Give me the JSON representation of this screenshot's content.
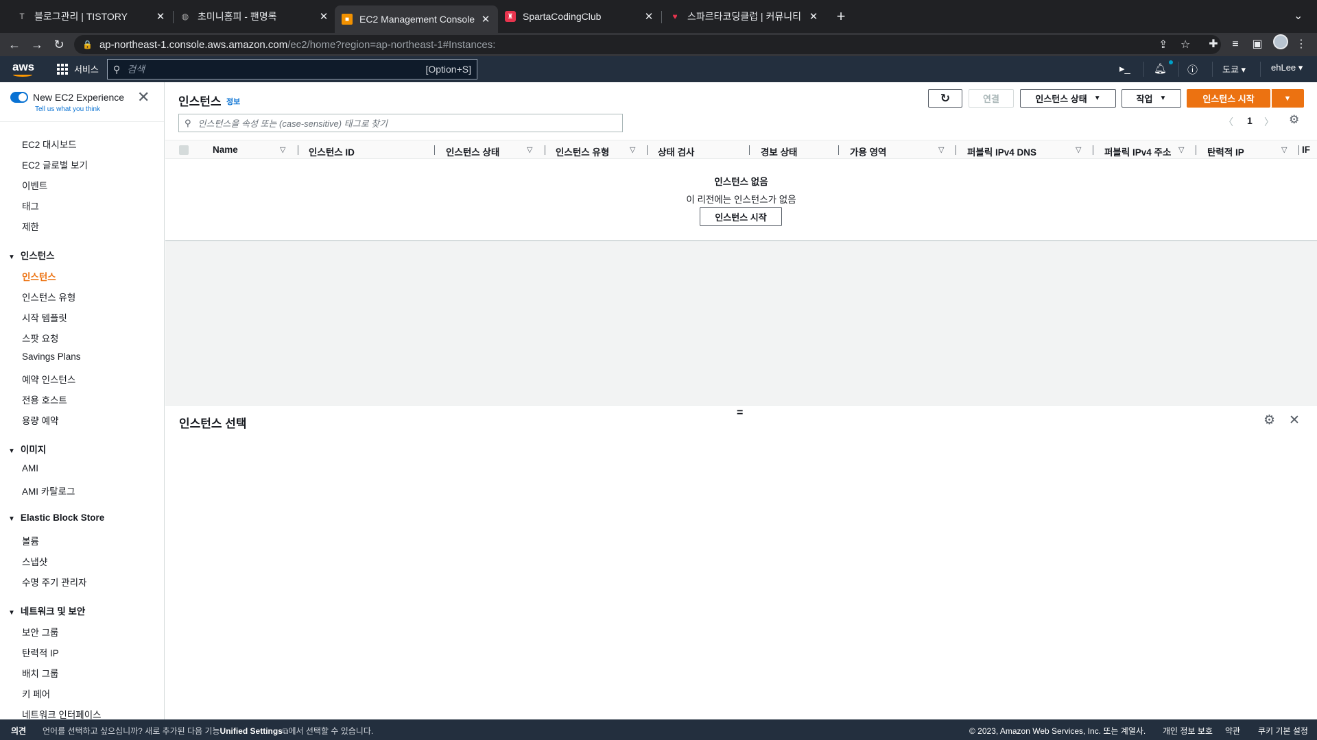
{
  "browser": {
    "tabs": [
      {
        "title": "블로그관리 | TISTORY",
        "icon": "tistory-favicon"
      },
      {
        "title": "초미니홈피 - 팬명록",
        "icon": "globe-favicon"
      },
      {
        "title": "EC2 Management Console",
        "icon": "ec2-favicon"
      },
      {
        "title": "SpartaCodingClub",
        "icon": "sparta-favicon"
      },
      {
        "title": "스파르타코딩클럽 | 커뮤니티",
        "icon": "heart-favicon"
      }
    ],
    "active_tab": 2,
    "url_host": "ap-northeast-1.console.aws.amazon.com",
    "url_path": "/ec2/home?region=ap-northeast-1#Instances:"
  },
  "aws_nav": {
    "logo": "aws",
    "services_label": "서비스",
    "search_placeholder": "검색",
    "search_hint": "[Option+S]",
    "region": "도쿄",
    "user": "ehLee"
  },
  "sidebar": {
    "experience_title": "New EC2 Experience",
    "experience_link": "Tell us what you think",
    "top_items": [
      "EC2 대시보드",
      "EC2 글로벌 보기",
      "이벤트",
      "태그",
      "제한"
    ],
    "groups": [
      {
        "title": "인스턴스",
        "items": [
          "인스턴스",
          "인스턴스 유형",
          "시작 템플릿",
          "스팟 요청",
          "Savings Plans",
          "예약 인스턴스",
          "전용 호스트",
          "용량 예약"
        ]
      },
      {
        "title": "이미지",
        "items": [
          "AMI",
          "AMI 카탈로그"
        ]
      },
      {
        "title": "Elastic Block Store",
        "items": [
          "볼륨",
          "스냅샷",
          "수명 주기 관리자"
        ]
      },
      {
        "title": "네트워크 및 보안",
        "items": [
          "보안 그룹",
          "탄력적 IP",
          "배치 그룹",
          "키 페어",
          "네트워크 인터페이스"
        ]
      }
    ],
    "active_item": "인스턴스"
  },
  "main": {
    "title": "인스턴스",
    "info_link": "정보",
    "buttons": {
      "connect": "연결",
      "instance_state": "인스턴스 상태",
      "actions": "작업",
      "launch": "인스턴스 시작"
    },
    "filter_placeholder": "인스턴스을 속성 또는 (case-sensitive) 태그로 찾기",
    "page_number": "1",
    "columns": [
      "Name",
      "인스턴스 ID",
      "인스턴스 상태",
      "인스턴스 유형",
      "상태 검사",
      "경보 상태",
      "가용 영역",
      "퍼블릭 IPv4 DNS",
      "퍼블릭 IPv4 주소",
      "탄력적 IP",
      "IF"
    ],
    "empty_title": "인스턴스 없음",
    "empty_subtitle": "이 리전에는 인스턴스가 없음",
    "empty_button": "인스턴스 시작",
    "detail_title": "인스턴스 선택"
  },
  "footer": {
    "feedback": "의견",
    "language_msg_before": "언어를 선택하고 싶으십니까? 새로 추가된 다음 기능",
    "language_msg_strong": "Unified Settings",
    "language_msg_after": "에서 선택할 수 있습니다.",
    "copyright": "© 2023, Amazon Web Services, Inc. 또는 계열사.",
    "privacy": "개인 정보 보호",
    "terms": "약관",
    "cookies": "쿠키 기본 설정"
  },
  "colors": {
    "aws_nav_bg": "#232f3e",
    "accent_orange": "#ec7211",
    "link_blue": "#0972d3"
  }
}
